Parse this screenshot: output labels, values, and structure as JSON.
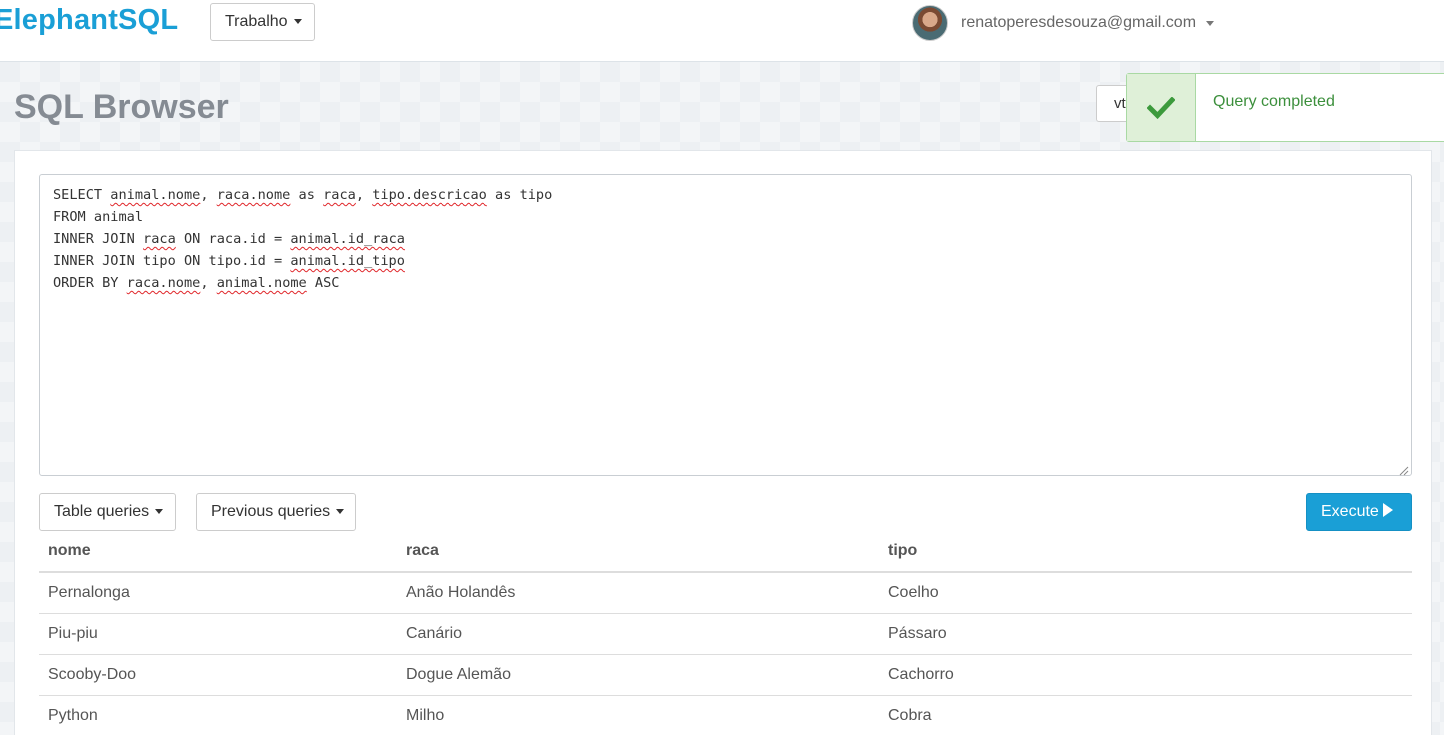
{
  "nav": {
    "brand": "ElephantSQL",
    "team": "Trabalho",
    "user_email": "renatoperesdesouza@gmail.com"
  },
  "page": {
    "title": "SQL Browser",
    "version_button": "vt"
  },
  "toast": {
    "message": "Query completed",
    "status": "success",
    "icon": "check-icon"
  },
  "editor": {
    "lines": [
      "SELECT animal.nome, raca.nome as raca, tipo.descricao as tipo",
      "FROM animal",
      "INNER JOIN raca ON raca.id = animal.id_raca",
      "INNER JOIN tipo ON tipo.id = animal.id_tipo",
      "ORDER BY raca.nome, animal.nome ASC"
    ]
  },
  "buttons": {
    "table_queries": "Table queries",
    "previous_queries": "Previous queries",
    "execute": "Execute"
  },
  "results": {
    "columns": [
      "nome",
      "raca",
      "tipo"
    ],
    "rows": [
      [
        "Pernalonga",
        "Anão Holandês",
        "Coelho"
      ],
      [
        "Piu-piu",
        "Canário",
        "Pássaro"
      ],
      [
        "Scooby-Doo",
        "Dogue Alemão",
        "Cachorro"
      ],
      [
        "Python",
        "Milho",
        "Cobra"
      ]
    ]
  },
  "colors": {
    "brand": "#1a9fd6",
    "success_text": "#3c8f3c",
    "success_bg": "#dff0d8"
  }
}
